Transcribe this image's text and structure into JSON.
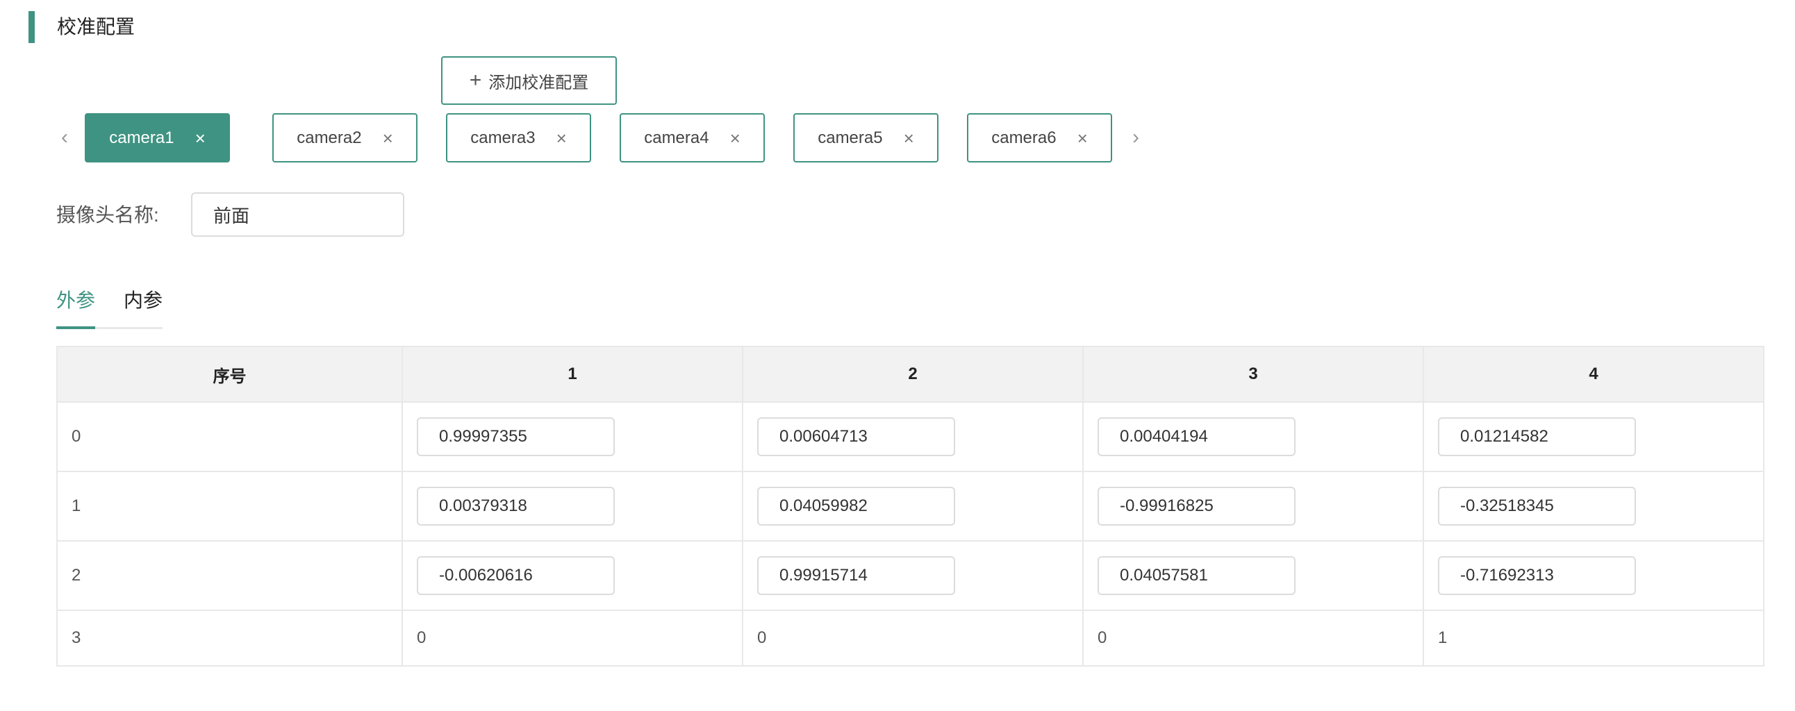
{
  "section": {
    "title": "校准配置",
    "accent_color": "#3f9382"
  },
  "add_button": {
    "icon": "plus-icon",
    "label": "添加校准配置"
  },
  "camera_tabs": {
    "prev_icon": "chevron-left-icon",
    "next_icon": "chevron-right-icon",
    "close_icon": "close-icon",
    "active_index": 0,
    "items": [
      {
        "label": "camera1"
      },
      {
        "label": "camera2"
      },
      {
        "label": "camera3"
      },
      {
        "label": "camera4"
      },
      {
        "label": "camera5"
      },
      {
        "label": "camera6"
      }
    ]
  },
  "camera_name": {
    "label": "摄像头名称:",
    "value": "前面"
  },
  "param_tabs": {
    "active": "外参",
    "items": [
      "外参",
      "内参"
    ]
  },
  "matrix_table": {
    "headers": [
      "序号",
      "1",
      "2",
      "3",
      "4"
    ],
    "rows": [
      {
        "index": "0",
        "cells": [
          "0.99997355",
          "0.00604713",
          "0.00404194",
          "0.01214582"
        ],
        "editable": true
      },
      {
        "index": "1",
        "cells": [
          "0.00379318",
          "0.04059982",
          "-0.99916825",
          "-0.32518345"
        ],
        "editable": true
      },
      {
        "index": "2",
        "cells": [
          "-0.00620616",
          "0.99915714",
          "0.04057581",
          "-0.71692313"
        ],
        "editable": true
      },
      {
        "index": "3",
        "cells": [
          "0",
          "0",
          "0",
          "1"
        ],
        "editable": false
      }
    ]
  }
}
